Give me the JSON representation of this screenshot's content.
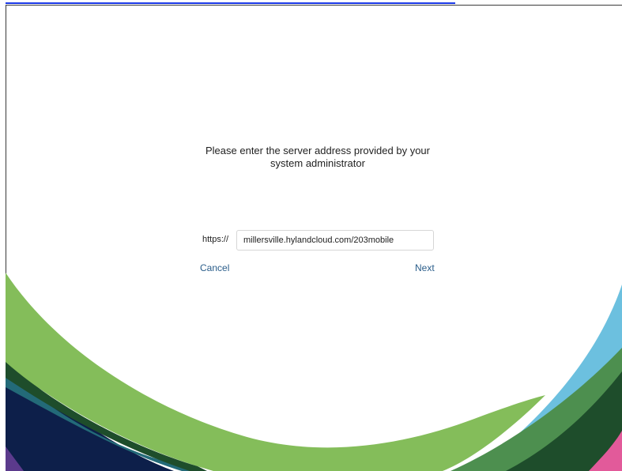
{
  "dialog": {
    "prompt_line1": "Please enter the server address provided by your",
    "prompt_line2": "system administrator",
    "scheme_label": "https://",
    "server_value": "millersville.hylandcloud.com/203mobile",
    "cancel_label": "Cancel",
    "next_label": "Next"
  },
  "colors": {
    "link_blue": "#2a5d8a",
    "wave_green": "#84bd5a",
    "wave_dark_green": "#1e4d2b",
    "wave_navy": "#0d1f4a",
    "wave_teal": "#236a78",
    "wave_light_blue": "#6cc0df",
    "wave_pink": "#e25a9a",
    "wave_purple": "#5b3a8c"
  }
}
